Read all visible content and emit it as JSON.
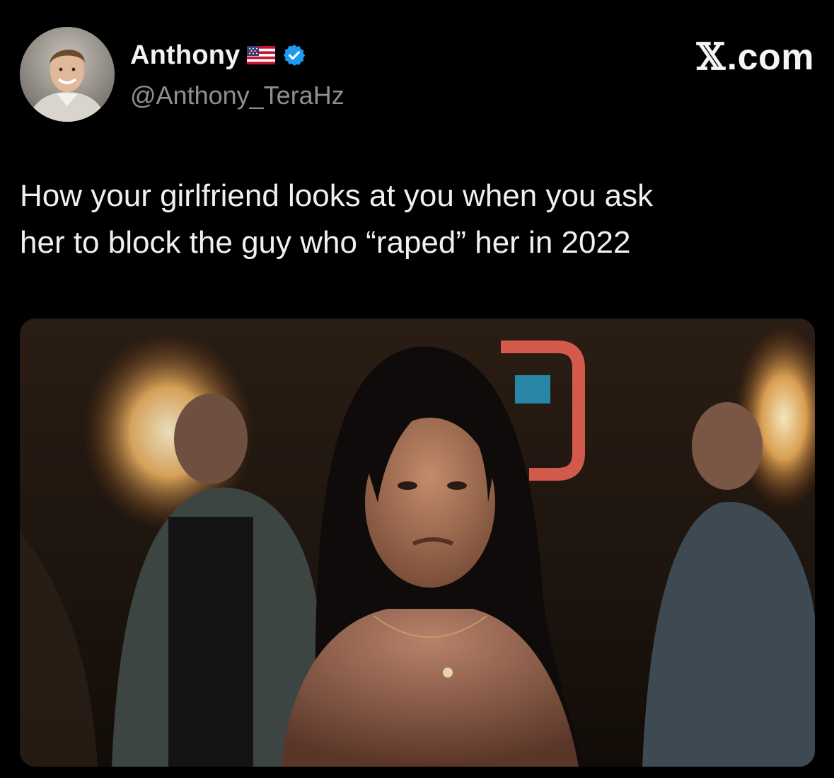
{
  "tweet": {
    "author": {
      "display_name": "Anthony",
      "handle": "@Anthony_TeraHz",
      "flag_icon": "us-flag-icon",
      "verified_icon": "verified-badge-icon",
      "avatar_icon": "profile-photo"
    },
    "brand_watermark": {
      "symbol": "𝕏",
      "suffix": ".com"
    },
    "text": "How your girlfriend looks at you when you ask\nher to block the guy who “raped” her in 2022",
    "media": {
      "type": "photo"
    }
  },
  "colors": {
    "background": "#000000",
    "primary_text": "#e7e9ea",
    "secondary_text": "#8b9096",
    "verified_blue": "#1d9bf0"
  }
}
